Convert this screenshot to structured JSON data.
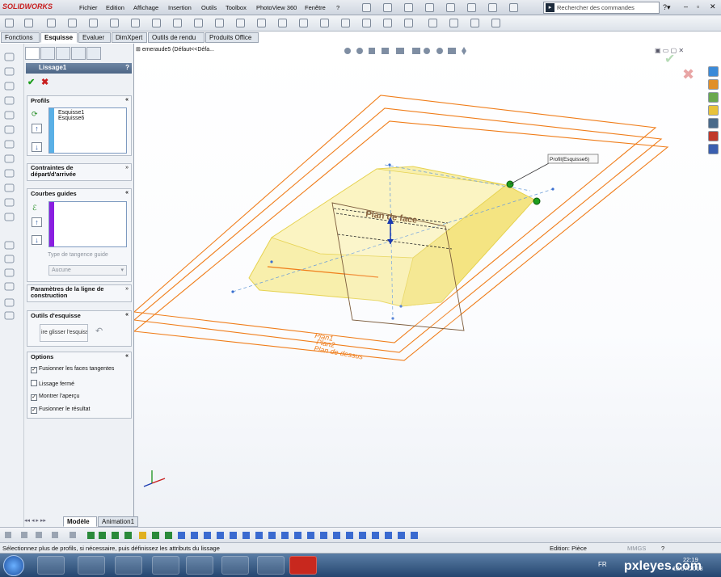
{
  "app": {
    "logo": "SOLIDWORKS"
  },
  "menu": [
    "Fichier",
    "Edition",
    "Affichage",
    "Insertion",
    "Outils",
    "Toolbox",
    "PhotoView 360",
    "Fenêtre",
    "?"
  ],
  "search": {
    "placeholder": "Rechercher des commandes"
  },
  "command_tabs": [
    "Fonctions",
    "Esquisse",
    "Evaluer",
    "DimXpert",
    "Outils de rendu",
    "Produits Office"
  ],
  "active_command_tab": "Esquisse",
  "feature": {
    "title": "Lissage1",
    "help": "?",
    "ok": "✔",
    "cancel": "✖"
  },
  "sections": {
    "profils": {
      "title": "Profils",
      "items": [
        "Esquisse1",
        "Esquisse6"
      ]
    },
    "contraintes": {
      "title": "Contraintes de départ/d'arrivée"
    },
    "courbes": {
      "title": "Courbes guides",
      "tangency_label": "Type de tangence guide",
      "tangency_value": "Aucune"
    },
    "parametres": {
      "title": "Paramètres de la ligne de construction"
    },
    "outils": {
      "title": "Outils d'esquisse",
      "drag_button": "ire glisser l'esquiss"
    },
    "options": {
      "title": "Options",
      "items": [
        {
          "label": "Fusionner les faces tangentes",
          "checked": true
        },
        {
          "label": "Lissage fermé",
          "checked": false
        },
        {
          "label": "Montrer l'aperçu",
          "checked": true
        },
        {
          "label": "Fusionner le résultat",
          "checked": true
        }
      ]
    }
  },
  "tree": {
    "label": "emeraude5  (Défaut<<Défa..."
  },
  "viewport": {
    "callout": "Profil(Esquisse6)",
    "plane_face": "Plan de face",
    "plane_1": "Plan1",
    "plane_2": "Plan2",
    "plane_top": "Plan de dessus"
  },
  "bottom_tabs": [
    "Modèle",
    "Animation1"
  ],
  "status": {
    "message": "Sélectionnez plus de profils, si nécessaire, puis définissez les attributs du lissage",
    "mode": "Edition: Pièce",
    "units": "MMGS"
  },
  "taskbar": {
    "lang": "FR",
    "time": "22:19",
    "date": "18/07/2013",
    "watermark": "pxleyes.com"
  },
  "colors": {
    "plane_orange": "#f07d1a",
    "loft_yellow": "#f5e98a",
    "panel_bg": "#eef1f5"
  }
}
